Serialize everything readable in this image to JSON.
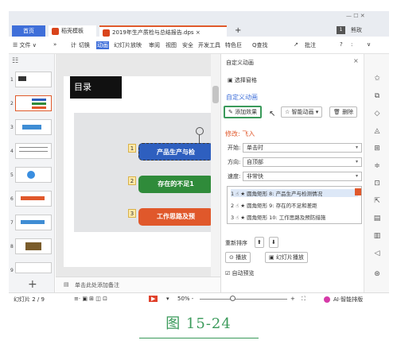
{
  "window": {
    "tab_home": "首页",
    "tab_template": "稻壳模板",
    "tab_doc": "2019年生产质检与总结报告.dps",
    "tab_close": "×",
    "tab_add": "+",
    "win_controls": "— ☐ ✕",
    "badge": "1",
    "user": "熊玫"
  },
  "menu": {
    "file": "☰ 文件 ∨",
    "arrows": "»",
    "tabs": [
      "计",
      "切换",
      "动画",
      "幻灯片放映",
      "审阅",
      "视图",
      "安全",
      "开发工具",
      "特色巨"
    ],
    "active_tab": "动画",
    "search": "Q查找",
    "annotate": "批注",
    "help": "?",
    "more": ":",
    "collapse": "∨"
  },
  "thumbnails": {
    "nums": [
      "1",
      "2",
      "3",
      "4",
      "5",
      "6",
      "7",
      "8",
      "9"
    ],
    "selected": "2",
    "add": "+"
  },
  "slide": {
    "title": "目录",
    "items": [
      {
        "num": "1",
        "text": "产品生产与检",
        "color": "#2e5fbf"
      },
      {
        "num": "2",
        "text": "存在的不足1",
        "color": "#2f8b3a"
      },
      {
        "num": "3",
        "text": "工作思路及预",
        "color": "#e0582b"
      }
    ]
  },
  "panel": {
    "header": "自定义动画",
    "select_pane": "选择窗格",
    "section": "自定义动画",
    "add_effect": "添加效果",
    "smart_anim": "智能动画",
    "delete": "删除",
    "modify": "修改: 飞入",
    "start_label": "开始:",
    "start_value": "单击时",
    "direction_label": "方向:",
    "direction_value": "自顶部",
    "speed_label": "速度:",
    "speed_value": "非常快",
    "list": [
      "1 ☝ ★ 圆角矩形 8: 产品生产与检测情况",
      "2 ☝ ★ 圆角矩形 9: 存在的不足和差距",
      "3 ☝ ★ 圆角矩形 10: 工作思路及预防措施"
    ],
    "reorder": "重新排序",
    "play": "播放",
    "slideshow": "幻灯片播放",
    "auto_preview": "自动预览"
  },
  "notes": {
    "placeholder": "单击此处添加备注"
  },
  "status": {
    "slide": "幻灯片 2 / 9",
    "zoom": "50% -",
    "zoom_plus": "+",
    "ai": "AI·智能排版"
  },
  "caption": "图 15-24"
}
